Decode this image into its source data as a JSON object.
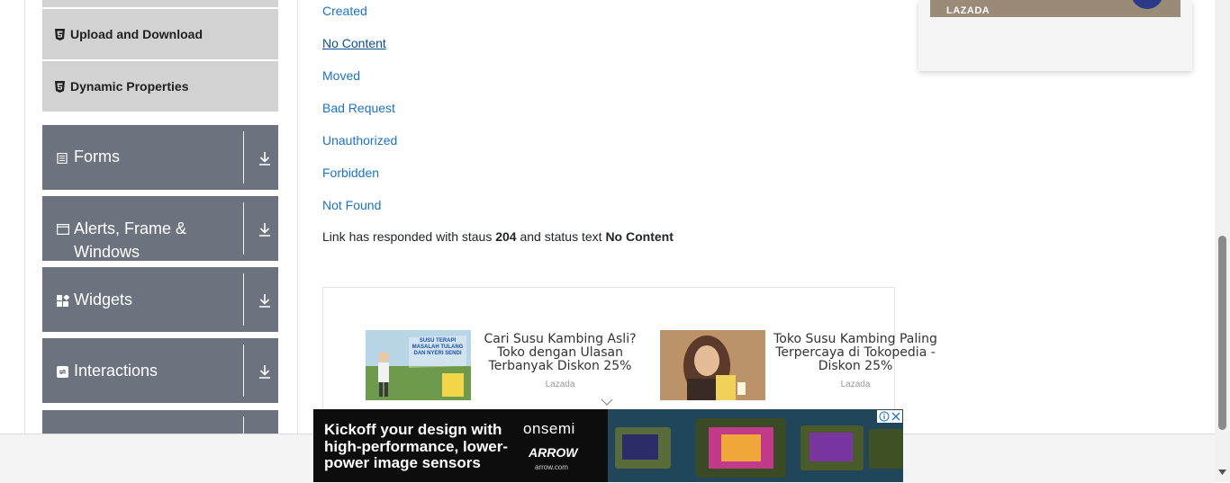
{
  "sidebar": {
    "sub_items": [
      {
        "label": "Upload and Download"
      },
      {
        "label": "Dynamic Properties"
      }
    ],
    "groups": [
      {
        "label": "Forms"
      },
      {
        "label_line1": "Alerts, Frame &",
        "label_line2": "Windows"
      },
      {
        "label": "Widgets"
      },
      {
        "label": "Interactions"
      }
    ]
  },
  "main": {
    "links": [
      {
        "label": "Created"
      },
      {
        "label": "No Content"
      },
      {
        "label": "Moved"
      },
      {
        "label": "Bad Request"
      },
      {
        "label": "Unauthorized"
      },
      {
        "label": "Forbidden"
      },
      {
        "label": "Not Found"
      }
    ],
    "status": {
      "prefix": "Link has responded with staus",
      "code": "204",
      "middle": "and status text",
      "text": "No Content"
    }
  },
  "ads": {
    "card_brand": "LAZADA",
    "items": [
      {
        "title": "Cari Susu Kambing Asli? Toko dengan Ulasan Terbanyak Diskon 25%",
        "source": "Lazada",
        "image_text": "SUSU TERAPI MASALAH TULANG DAN NYERI SENDI"
      },
      {
        "title": "Toko Susu Kambing Paling Terpercaya di Tokopedia - Diskon 25%",
        "source": "Lazada"
      }
    ],
    "banner": {
      "headline": "Kickoff your design with high-performance, lower-power image sensors",
      "brand1": "onsemi",
      "brand2": "ARROW",
      "url": "arrow.com",
      "adchoices_icon": "info-icon",
      "close_icon": "close-icon"
    }
  },
  "colors": {
    "link": "#1a73c5",
    "group_bg": "#6c737e",
    "sub_item_bg": "#d2d2d2"
  }
}
